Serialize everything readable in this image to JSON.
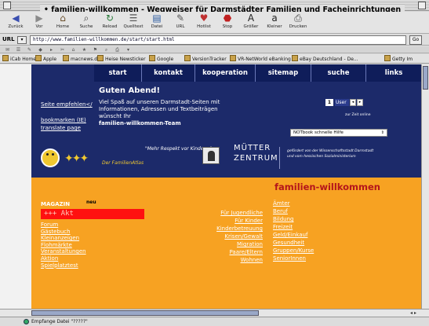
{
  "window": {
    "title": "• familien-willkommen - Wegweiser für Darmstädter Familien und Facheinrichtungen"
  },
  "toolbar": {
    "buttons": [
      {
        "label": "Zurück",
        "icon": "back-arrow"
      },
      {
        "label": "Vor",
        "icon": "forward-arrow"
      },
      {
        "label": "Home",
        "icon": "home"
      },
      {
        "label": "Suche",
        "icon": "search"
      },
      {
        "label": "Reload",
        "icon": "reload"
      },
      {
        "label": "Quelltext",
        "icon": "source"
      },
      {
        "label": "Datei",
        "icon": "file"
      },
      {
        "label": "URL",
        "icon": "url"
      },
      {
        "label": "Hotlist",
        "icon": "hotlist"
      },
      {
        "label": "Stop",
        "icon": "stop"
      },
      {
        "label": "Größer",
        "icon": "bigger"
      },
      {
        "label": "Kleiner",
        "icon": "smaller"
      },
      {
        "label": "Drucken",
        "icon": "print"
      }
    ]
  },
  "urlbar": {
    "label": "URL",
    "value": "http://www.familien-willkommen.de/start/start.html",
    "go_label": "Go"
  },
  "bookmarks": [
    "iCab Home",
    "Apple",
    "macnews.de",
    "Heise Newsticker",
    "Google",
    "VersionTracker",
    "VR-NetWorld eBanking",
    "eBay Deutschland - De...",
    "Getty Im"
  ],
  "site": {
    "nav": [
      "start",
      "kontakt",
      "kooperation",
      "sitemap",
      "suche",
      "links"
    ],
    "greeting": "Guten Abend!",
    "intro_lines": [
      "Viel Spaß auf unseren Darmstadt-Seiten mit",
      "Informationen, Adressen und Textbeiträgen",
      "wünscht Ihr"
    ],
    "intro_team": "familien-willkommen-Team",
    "left_links": {
      "recommend": "Seite empfehlen</",
      "bookmark": "bookmarken (IE)",
      "translate": "translate page"
    },
    "user_box": {
      "t": "1",
      "user": "User",
      "b1": "◂",
      "b2": "▸"
    },
    "online_text": "zur Zeit online",
    "help_select": {
      "value": "NOTbook schnelle Hilfe",
      "arrow": "⇕"
    },
    "banner": {
      "kids_glyphs": "✦✦✦",
      "atlas": "Der FamilienAtlas",
      "quote": "\"Mehr Respekt vor Kindern.\"",
      "mz_line1": "MÜTTER",
      "mz_line2": "ZENTRUM",
      "funded_line1": "gefördert von der Wissenschaftsstadt Darmstadt",
      "funded_line2": "und vom hessischen Sozialministerium"
    },
    "brand_title": "familien-willkommen",
    "magazin": {
      "label": "MAGAZIN",
      "tag": "neu"
    },
    "ticker": "+++ Akt",
    "menu_left": [
      "Forum",
      "Gästebuch",
      "Kleinanzeigen",
      "Flohmärkte",
      "Veranstaltungen",
      "Aktion",
      "Spielplatztest"
    ],
    "menu_mid": [
      "Für Jugendliche",
      "Für Kinder",
      "Kinderbetreuung",
      "Krisen/Gewalt",
      "Migration",
      "Paare/Eltern",
      "Wohnen"
    ],
    "menu_right": [
      "Ämter",
      "Beruf",
      "Bildung",
      "Freizeit",
      "Geld/Einkauf",
      "Gesundheit",
      "Gruppen/Kurse",
      "SeniorInnen"
    ]
  },
  "status": {
    "text": "Empfange Datei \"?????\""
  }
}
